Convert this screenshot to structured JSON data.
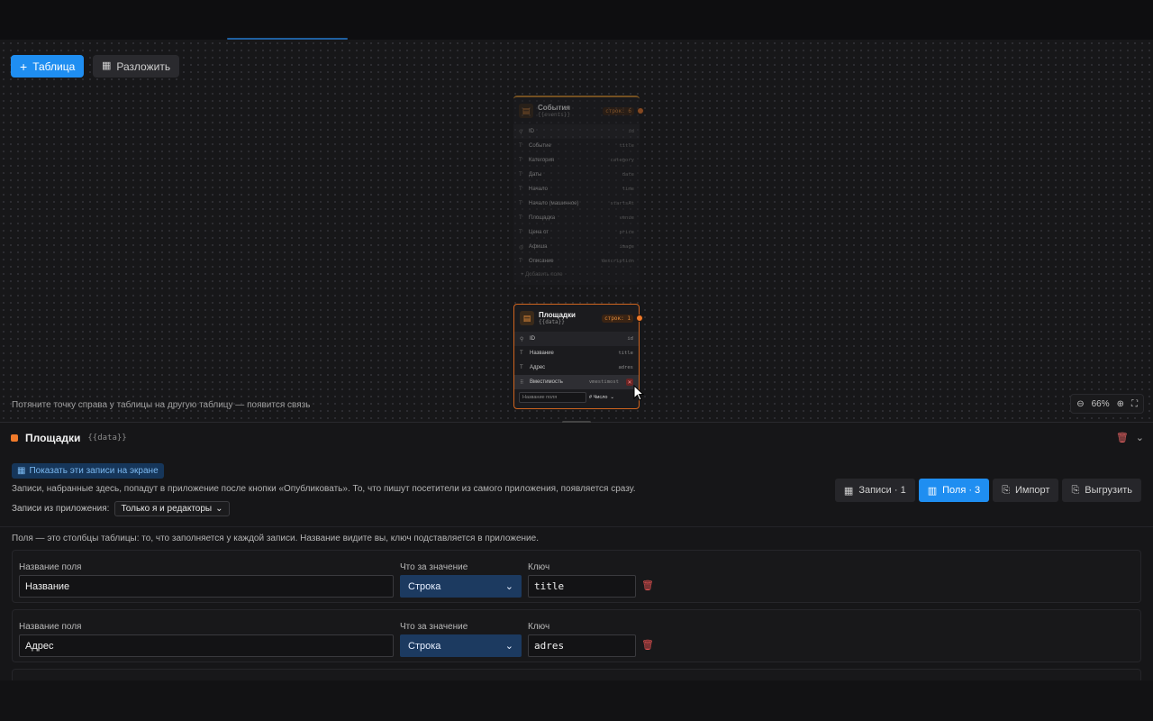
{
  "toolbar": {
    "add_table_label": "Таблица",
    "layout_label": "Разложить"
  },
  "canvas": {
    "hint": "Потяните точку справа у таблицы на другую таблицу — появится связь",
    "zoom": "66%",
    "nodes": {
      "events": {
        "title": "События",
        "key": "{{events}}",
        "rows_badge": "строк: 6",
        "fields": [
          {
            "label": "ID",
            "key": "id"
          },
          {
            "label": "Событие",
            "key": "title"
          },
          {
            "label": "Категория",
            "key": "category"
          },
          {
            "label": "Даты",
            "key": "date"
          },
          {
            "label": "Начало",
            "key": "time"
          },
          {
            "label": "Начало (машинное)",
            "key": "startsAt"
          },
          {
            "label": "Площадка",
            "key": "venue"
          },
          {
            "label": "Цена от",
            "key": "price"
          },
          {
            "label": "Афиша",
            "key": "image"
          },
          {
            "label": "Описание",
            "key": "description"
          }
        ],
        "add_field": "+ Добавить поле"
      },
      "venues": {
        "title": "Площадки",
        "key": "{{data}}",
        "rows_badge": "строк: 1",
        "fields": [
          {
            "label": "ID",
            "key": "id"
          },
          {
            "label": "Название",
            "key": "title"
          },
          {
            "label": "Адрес",
            "key": "adres"
          },
          {
            "label": "Вместимость",
            "key": "vmestimost"
          }
        ],
        "new_field_placeholder": "Название поля",
        "new_field_type": "# Число"
      }
    }
  },
  "panel": {
    "title": "Площадки",
    "key": "{{data}}",
    "show_button": "Показать эти записи на экране",
    "description": "Записи, набранные здесь, попадут в приложение после кнопки «Опубликовать». То, что пишут посетители из самого приложения, появляется сразу.",
    "source_label": "Записи из приложения:",
    "source_value": "Только я и редакторы",
    "tabs": [
      {
        "label": "Записи · 1",
        "icon": "table-icon",
        "active": false
      },
      {
        "label": "Поля · 3",
        "icon": "columns-icon",
        "active": true
      },
      {
        "label": "Импорт",
        "icon": "file-import-icon",
        "active": false
      },
      {
        "label": "Выгрузить",
        "icon": "file-export-icon",
        "active": false
      }
    ],
    "fields_description": "Поля — это столбцы таблицы: то, что заполняется у каждой записи. Название видите вы, ключ подставляется в приложение.",
    "field_labels": {
      "name": "Название поля",
      "type": "Что за значение",
      "key": "Ключ"
    },
    "fields": [
      {
        "name": "Название",
        "type": "Строка",
        "key": "title"
      },
      {
        "name": "Адрес",
        "type": "Строка",
        "key": "adres"
      }
    ]
  },
  "colors": {
    "accent": "#1f8ef1",
    "node_border": "#d0651f",
    "danger": "#e05050"
  }
}
